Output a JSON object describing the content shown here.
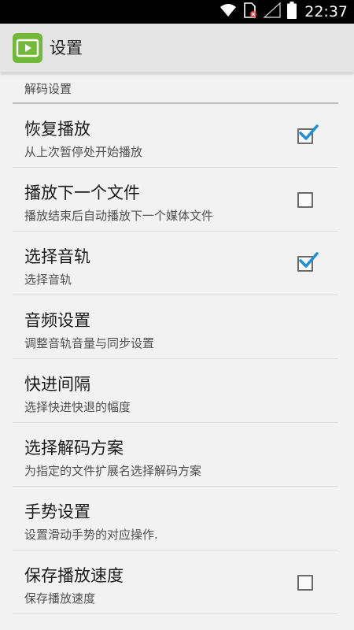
{
  "status_bar": {
    "time": "22:37",
    "icons": [
      "wifi-icon",
      "sim-card-no-service-icon",
      "signal-empty-icon",
      "battery-icon"
    ]
  },
  "app_bar": {
    "title": "设置",
    "icon": "video-player-app-icon",
    "icon_color": "#72b83a"
  },
  "category": {
    "label": "解码设置"
  },
  "preferences": [
    {
      "title": "恢复播放",
      "summary": "从上次暂停处开始播放",
      "checkbox": true,
      "checked": true
    },
    {
      "title": "播放下一个文件",
      "summary": "播放结束后自动播放下一个媒体文件",
      "checkbox": true,
      "checked": false
    },
    {
      "title": "选择音轨",
      "summary": "选择音轨",
      "checkbox": true,
      "checked": true
    },
    {
      "title": "音频设置",
      "summary": "调整音轨音量与同步设置",
      "checkbox": false
    },
    {
      "title": "快进间隔",
      "summary": "选择快进快退的幅度",
      "checkbox": false
    },
    {
      "title": "选择解码方案",
      "summary": "为指定的文件扩展名选择解码方案",
      "checkbox": false
    },
    {
      "title": "手势设置",
      "summary": "设置滑动手势的对应操作.",
      "checkbox": false
    },
    {
      "title": "保存播放速度",
      "summary": "保存播放速度",
      "checkbox": true,
      "checked": false
    }
  ],
  "colors": {
    "accent": "#1f8fd6",
    "app_bar": "#e4e4e4",
    "background": "#f2f2f2"
  }
}
